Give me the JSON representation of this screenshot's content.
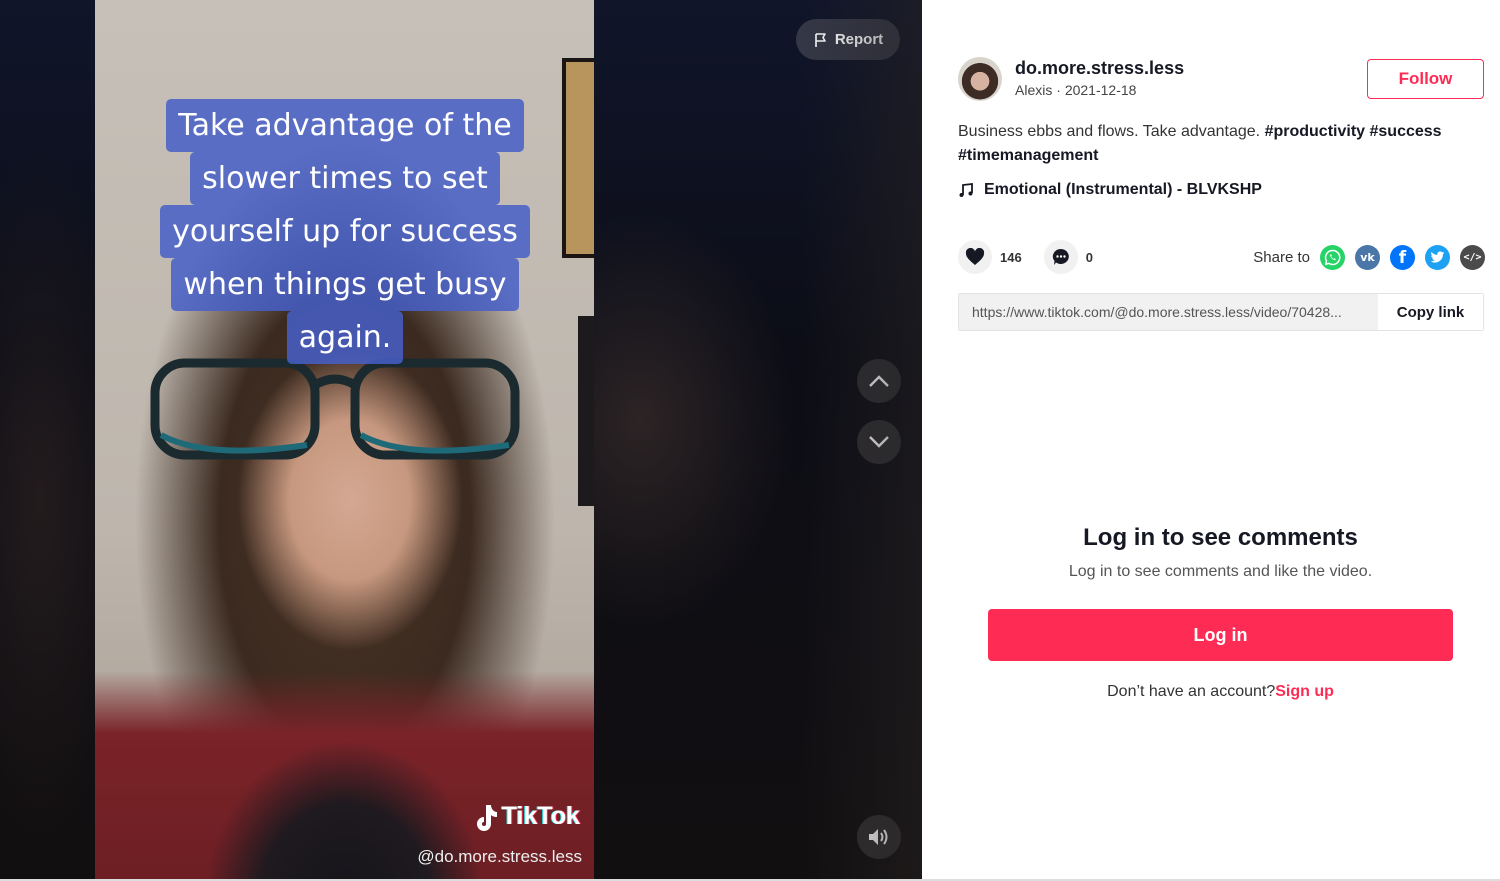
{
  "video": {
    "caption_lines": [
      "Take advantage of the",
      "slower times to set",
      "yourself up for success",
      "when things get busy",
      "again."
    ],
    "watermark_brand": "TikTok",
    "watermark_handle": "@do.more.stress.less",
    "report_label": "Report",
    "icons": {
      "report": "flag-icon",
      "prev": "chevron-up-icon",
      "next": "chevron-down-icon",
      "volume": "volume-icon",
      "brand": "tiktok-logo-icon"
    }
  },
  "author": {
    "username": "do.more.stress.less",
    "display_name": "Alexis",
    "separator": " · ",
    "date": "2021-12-18",
    "follow_label": "Follow"
  },
  "description": {
    "text": "Business ebbs and flows. Take advantage. ",
    "hashtags": [
      "#productivity",
      "#success",
      "#timemanagement"
    ]
  },
  "music": {
    "icon": "music-note-icon",
    "title": "Emotional (Instrumental) - BLVKSHP"
  },
  "stats": {
    "likes": "146",
    "comments": "0"
  },
  "share": {
    "label": "Share to",
    "targets": [
      {
        "name": "whatsapp",
        "icon": "whatsapp-icon",
        "color": "#25d366"
      },
      {
        "name": "vk",
        "icon": "vk-icon",
        "color": "#4a76a8"
      },
      {
        "name": "facebook",
        "icon": "facebook-icon",
        "color": "#0075fa"
      },
      {
        "name": "twitter",
        "icon": "twitter-icon",
        "color": "#1da1f2"
      },
      {
        "name": "embed",
        "icon": "embed-code-icon",
        "color": "#4b4b4b"
      }
    ]
  },
  "link": {
    "url": "https://www.tiktok.com/@do.more.stress.less/video/70428...",
    "copy_label": "Copy link"
  },
  "comments_gate": {
    "title": "Log in to see comments",
    "subtitle": "Log in to see comments and like the video.",
    "login_label": "Log in",
    "signup_prompt": "Don’t have an account?",
    "signup_label": "Sign up"
  },
  "colors": {
    "brand": "#fe2c55",
    "caption_bg": "#465fc8",
    "text_primary": "#161823"
  }
}
